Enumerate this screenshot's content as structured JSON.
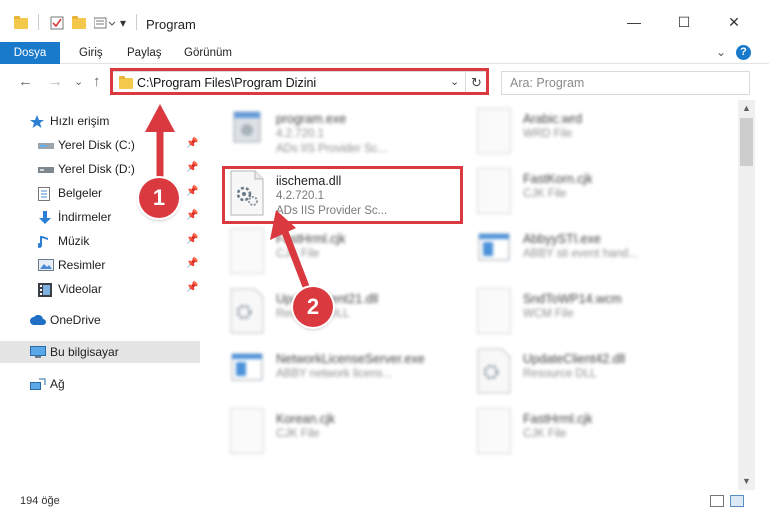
{
  "window": {
    "title": "Program",
    "minimize": "—",
    "maximize": "☐",
    "close": "✕"
  },
  "ribbon": {
    "tabs": [
      "Dosya",
      "Giriş",
      "Paylaş",
      "Görünüm"
    ],
    "expand": "⌄",
    "help": "?"
  },
  "address": {
    "path": "C:\\Program Files\\Program Dizini",
    "dropdown": "⌄",
    "refresh": "↻",
    "search_placeholder": "Ara: Program"
  },
  "nav": {
    "back": "←",
    "forward": "→",
    "dropdown": "⌄",
    "up": "↑"
  },
  "sidebar": {
    "items": [
      {
        "label": "Hızlı erişim",
        "icon": "star-icon"
      },
      {
        "label": "Yerel Disk (C:)",
        "icon": "drive-icon",
        "pinned": true
      },
      {
        "label": "Yerel Disk (D:)",
        "icon": "drive-icon",
        "pinned": true
      },
      {
        "label": "Belgeler",
        "icon": "document-icon",
        "pinned": true
      },
      {
        "label": "İndirmeler",
        "icon": "download-icon",
        "pinned": true
      },
      {
        "label": "Müzik",
        "icon": "music-icon",
        "pinned": true
      },
      {
        "label": "Resimler",
        "icon": "picture-icon",
        "pinned": true
      },
      {
        "label": "Videolar",
        "icon": "video-icon",
        "pinned": true
      },
      {
        "label": "OneDrive",
        "icon": "cloud-icon"
      },
      {
        "label": "Bu bilgisayar",
        "icon": "computer-icon",
        "selected": true
      },
      {
        "label": "Ağ",
        "icon": "network-icon"
      }
    ],
    "pin_glyph": "📌"
  },
  "files": [
    {
      "name": "program.exe",
      "version": "4.2.720.1",
      "desc": "ADs IIS Provider Sc...",
      "blurred": true
    },
    {
      "name": "Arabic.wrd",
      "version": "WRD File",
      "desc": "",
      "blurred": true
    },
    {
      "name": "iischema.dll",
      "version": "4.2.720.1",
      "desc": "ADs IIS Provider Sc...",
      "blurred": false
    },
    {
      "name": "FastKorn.cjk",
      "version": "CJK File",
      "desc": "",
      "blurred": true
    },
    {
      "name": "FastHrml.cjk",
      "version": "CJK File",
      "desc": "",
      "blurred": true
    },
    {
      "name": "AbbyySTI.exe",
      "version": "ABBY sti event hand...",
      "desc": "",
      "blurred": true
    },
    {
      "name": "UpdateClient21.dll",
      "version": "Resource DLL",
      "desc": "",
      "blurred": true
    },
    {
      "name": "SndToWP14.wcm",
      "version": "WCM File",
      "desc": "",
      "blurred": true
    },
    {
      "name": "NetworkLicenseServer.exe",
      "version": "ABBY network licens...",
      "desc": "",
      "blurred": true
    },
    {
      "name": "UpdateClient42.dll",
      "version": "Resource DLL",
      "desc": "",
      "blurred": true
    },
    {
      "name": "Korean.cjk",
      "version": "CJK File",
      "desc": "",
      "blurred": true
    },
    {
      "name": "FastHrml.cjk",
      "version": "CJK File",
      "desc": "",
      "blurred": true
    }
  ],
  "status": {
    "count": "194 öğe"
  },
  "callouts": {
    "one": "1",
    "two": "2"
  },
  "colors": {
    "accent": "#1979ca",
    "highlight": "#d9393f"
  }
}
